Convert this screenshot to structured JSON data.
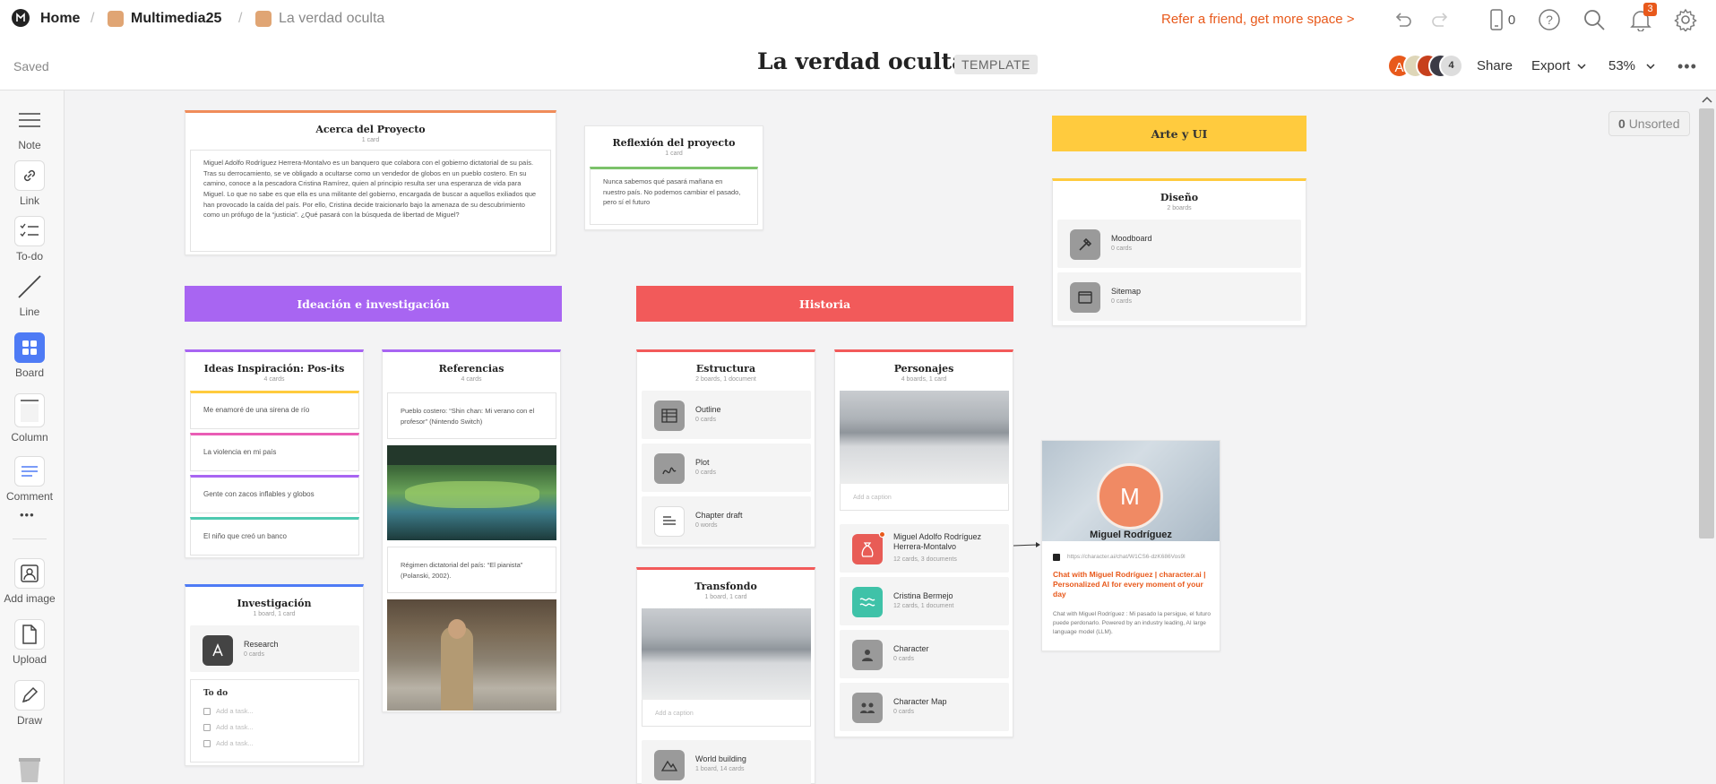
{
  "header": {
    "home": "Home",
    "crumb1": "Multimedia25",
    "crumb2": "La verdad oculta",
    "refer": "Refer a friend, get more space >",
    "phone_count": "0",
    "notif_count": "3",
    "title": "La verdad oculta",
    "template_badge": "TEMPLATE",
    "saved": "Saved",
    "avatar_letter": "A",
    "collab_count": "4",
    "share": "Share",
    "export": "Export",
    "zoom": "53%",
    "accent": "#e8591b"
  },
  "tools": [
    {
      "label": "Note",
      "icon": "note-icon"
    },
    {
      "label": "Link",
      "icon": "link-icon"
    },
    {
      "label": "To-do",
      "icon": "todo-icon"
    },
    {
      "label": "Line",
      "icon": "line-icon"
    },
    {
      "label": "Board",
      "icon": "board-icon"
    },
    {
      "label": "Column",
      "icon": "column-icon"
    },
    {
      "label": "Comment",
      "icon": "comment-icon"
    },
    {
      "label": "Add image",
      "icon": "image-icon"
    },
    {
      "label": "Upload",
      "icon": "upload-icon"
    },
    {
      "label": "Draw",
      "icon": "draw-icon"
    }
  ],
  "unsorted": {
    "count": "0",
    "label": "Unsorted"
  },
  "about": {
    "title": "Acerca del Proyecto",
    "sub": "1 card",
    "text": "Miguel Adolfo Rodríguez Herrera-Montalvo es un banquero que colabora con el gobierno dictatorial de su país. Tras su derrocamiento, se ve obligado a ocultarse como un vendedor de globos en un pueblo costero. En su camino, conoce a la pescadora Cristina Ramírez, quien al principio resulta ser una esperanza de vida para Miguel. Lo que no sabe es que ella es una militante del gobierno, encargada de buscar a aquellos exiliados que han provocado la caída del país. Por ello, Cristina decide traicionarlo bajo la amenaza de su descubrimiento como un prófugo de la “justicia”. ¿Qué pasará con la búsqueda de libertad de Miguel?"
  },
  "reflection": {
    "title": "Reflexión del proyecto",
    "sub": "1 card",
    "text": "Nunca sabemos qué pasará mañana en nuestro país. No podemos cambiar el pasado, pero sí el futuro"
  },
  "banners": {
    "arte": "Arte y UI",
    "ideacion": "Ideación e investigación",
    "historia": "Historia"
  },
  "diseno": {
    "title": "Diseño",
    "sub": "2 boards",
    "items": [
      {
        "title": "Moodboard",
        "sub": "0 cards"
      },
      {
        "title": "Sitemap",
        "sub": "0 cards"
      }
    ]
  },
  "ideas": {
    "title": "Ideas Inspiración: Pos-its",
    "sub": "4 cards",
    "items": [
      "Me enamoré de una sirena de río",
      "La violencia en mi país",
      "Gente con zacos inflables y globos",
      "El niño que creó un banco"
    ]
  },
  "referencias": {
    "title": "Referencias",
    "sub": "4 cards",
    "ref1": "Pueblo costero: “Shin chan: Mi verano con el profesor” (Nintendo Switch)",
    "ref2": "Régimen dictatorial del país: “El pianista” (Polanski, 2002)."
  },
  "investigacion": {
    "title": "Investigación",
    "sub": "1 board, 1 card",
    "item_title": "Research",
    "item_sub": "0 cards",
    "todo_title": "To do",
    "tasks": [
      "Add a task...",
      "Add a task...",
      "Add a task..."
    ]
  },
  "estructura": {
    "title": "Estructura",
    "sub": "2 boards, 1 document",
    "items": [
      {
        "title": "Outline",
        "sub": "0 cards"
      },
      {
        "title": "Plot",
        "sub": "0 cards"
      },
      {
        "title": "Chapter draft",
        "sub": "0 words"
      }
    ]
  },
  "transfondo": {
    "title": "Transfondo",
    "sub": "1 board, 1 card",
    "caption": "Add a caption",
    "item_title": "World building",
    "item_sub": "1 board, 14 cards"
  },
  "personajes": {
    "title": "Personajes",
    "sub": "4 boards, 1 card",
    "caption": "Add a caption",
    "items": [
      {
        "title": "Miguel Adolfo Rodríguez Herrera-Montalvo",
        "sub": "12 cards, 3 documents"
      },
      {
        "title": "Cristina Bermejo",
        "sub": "12 cards, 1 document"
      },
      {
        "title": "Character",
        "sub": "0 cards"
      },
      {
        "title": "Character Map",
        "sub": "0 cards"
      }
    ]
  },
  "link_card": {
    "avatar_letter": "M",
    "name": "Miguel Rodríguez",
    "url": "https://character.ai/chat/W1CS6-dzK686Vos9l",
    "title": "Chat with Miguel Rodríguez | character.ai | Personalized AI for every moment of your day",
    "desc": "Chat with Miguel Rodríguez : Mi pasado la persigue, el futuro puede perdonarlo. Powered by an industry leading, AI large language model (LLM)."
  }
}
